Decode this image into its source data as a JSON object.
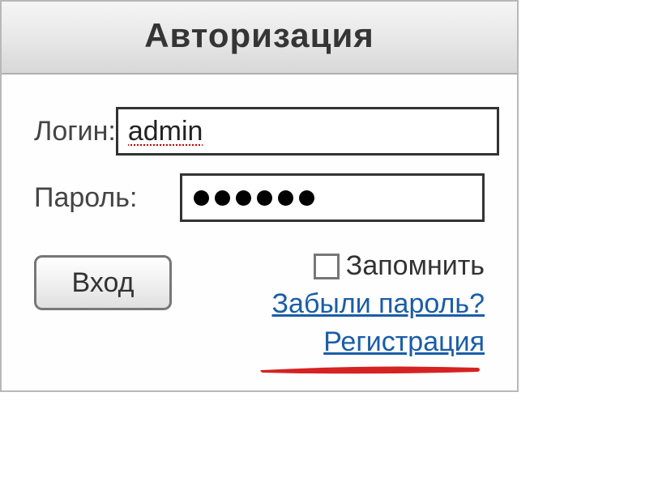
{
  "header": {
    "title": "Авторизация"
  },
  "form": {
    "login_label": "Логин:",
    "login_value": "admin",
    "password_label": "Пароль:",
    "password_value": "••••••",
    "password_length": 6
  },
  "actions": {
    "submit_label": "Вход",
    "remember_label": "Запомнить",
    "remember_checked": false,
    "forgot_label": "Забыли пароль?",
    "register_label": "Регистрация"
  },
  "colors": {
    "link": "#1a5da8",
    "mark": "#d62222"
  }
}
